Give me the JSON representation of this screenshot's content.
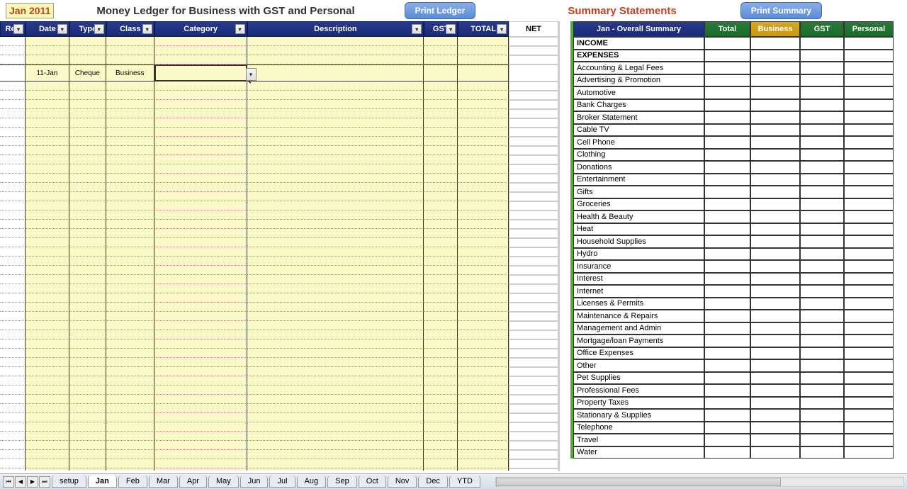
{
  "header": {
    "month": "Jan",
    "year": "2011",
    "title": "Money Ledger for Business with GST and Personal",
    "print_ledger": "Print Ledger",
    "summary_title": "Summary Statements",
    "print_summary": "Print Summary"
  },
  "ledger_columns": {
    "red": "Red",
    "date": "Date",
    "type": "Type",
    "class": "Class",
    "category": "Category",
    "description": "Description",
    "gst": "GST",
    "total": "TOTAL",
    "net": "NET"
  },
  "ledger_row": {
    "date": "11-Jan",
    "type": "Cheque",
    "class": "Business"
  },
  "summary_columns": {
    "main": "Jan - Overall Summary",
    "total": "Total",
    "business": "Business",
    "gst": "GST",
    "personal": "Personal"
  },
  "summary_rows": [
    {
      "label": "INCOME",
      "bold": true
    },
    {
      "label": "EXPENSES",
      "bold": true
    },
    {
      "label": "Accounting & Legal Fees"
    },
    {
      "label": "Advertising & Promotion"
    },
    {
      "label": "Automotive"
    },
    {
      "label": "Bank Charges"
    },
    {
      "label": "Broker Statement"
    },
    {
      "label": "Cable TV"
    },
    {
      "label": "Cell Phone"
    },
    {
      "label": "Clothing"
    },
    {
      "label": "Donations"
    },
    {
      "label": "Entertainment"
    },
    {
      "label": "Gifts"
    },
    {
      "label": "Groceries"
    },
    {
      "label": "Health & Beauty"
    },
    {
      "label": "Heat"
    },
    {
      "label": "Household Supplies"
    },
    {
      "label": "Hydro"
    },
    {
      "label": "Insurance"
    },
    {
      "label": "Interest"
    },
    {
      "label": "Internet"
    },
    {
      "label": "Licenses & Permits"
    },
    {
      "label": "Maintenance & Repairs"
    },
    {
      "label": "Management and Admin"
    },
    {
      "label": "Mortgage/loan Payments"
    },
    {
      "label": "Office Expenses"
    },
    {
      "label": "Other"
    },
    {
      "label": "Pet Supplies"
    },
    {
      "label": "Professional Fees"
    },
    {
      "label": "Property Taxes"
    },
    {
      "label": "Stationary & Supplies"
    },
    {
      "label": "Telephone"
    },
    {
      "label": "Travel"
    },
    {
      "label": "Water"
    }
  ],
  "tabs": [
    "setup",
    "Jan",
    "Feb",
    "Mar",
    "Apr",
    "May",
    "Jun",
    "Jul",
    "Aug",
    "Sep",
    "Oct",
    "Nov",
    "Dec",
    "YTD"
  ],
  "active_tab": "Jan"
}
